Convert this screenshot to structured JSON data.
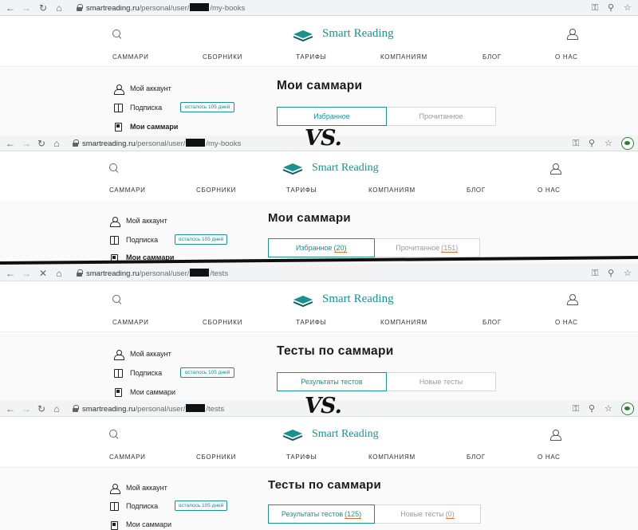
{
  "colors": {
    "accent": "#19928f",
    "count_underline": "#e8702a",
    "divider": "#0f0f0f"
  },
  "vs_label": "VS.",
  "comparisons": [
    {
      "before": {
        "url_host": "smartreading.ru",
        "url_prefix": "/personal/user/",
        "url_suffix": "/my-books",
        "logo_text": "Smart Reading",
        "menu": [
          "САММАРИ",
          "СБОРНИКИ",
          "ТАРИФЫ",
          "КОМПАНИЯМ",
          "БЛОГ",
          "О НАС"
        ],
        "sidebar": [
          {
            "label": "Мой аккаунт",
            "icon": "user-icon"
          },
          {
            "label": "Подписка",
            "icon": "book-icon",
            "badge": "осталось 105 дней"
          },
          {
            "label": "Мои саммари",
            "icon": "document-icon"
          }
        ],
        "page_title": "Мои саммари",
        "tabs": [
          {
            "label": "Избранное",
            "count": ""
          },
          {
            "label": "Прочитанное",
            "count": ""
          }
        ]
      },
      "after": {
        "url_host": "smartreading.ru",
        "url_prefix": "/personal/user/",
        "url_suffix": "/my-books",
        "logo_text": "Smart Reading",
        "menu": [
          "САММАРИ",
          "СБОРНИКИ",
          "ТАРИФЫ",
          "КОМПАНИЯМ",
          "БЛОГ",
          "О НАС"
        ],
        "sidebar": [
          {
            "label": "Мой аккаунт",
            "icon": "user-icon"
          },
          {
            "label": "Подписка",
            "icon": "book-icon",
            "badge": "осталось 105 дней"
          },
          {
            "label": "Мои саммари",
            "icon": "document-icon"
          }
        ],
        "page_title": "Мои саммари",
        "tabs": [
          {
            "label": "Избранное",
            "count": "(20)"
          },
          {
            "label": "Прочитанное",
            "count": "(151)"
          }
        ]
      }
    },
    {
      "before": {
        "url_host": "smartreading.ru",
        "url_prefix": "/personal/user/",
        "url_suffix": "/tests",
        "logo_text": "Smart Reading",
        "menu": [
          "САММАРИ",
          "СБОРНИКИ",
          "ТАРИФЫ",
          "КОМПАНИЯМ",
          "БЛОГ",
          "О НАС"
        ],
        "sidebar": [
          {
            "label": "Мой аккаунт",
            "icon": "user-icon"
          },
          {
            "label": "Подписка",
            "icon": "book-icon",
            "badge": "осталось 105 дней"
          },
          {
            "label": "Мои саммари",
            "icon": "document-icon"
          }
        ],
        "page_title": "Тесты по саммари",
        "tabs": [
          {
            "label": "Результаты тестов",
            "count": ""
          },
          {
            "label": "Новые тесты",
            "count": ""
          }
        ]
      },
      "after": {
        "url_host": "smartreading.ru",
        "url_prefix": "/personal/user/",
        "url_suffix": "/tests",
        "logo_text": "Smart Reading",
        "menu": [
          "САММАРИ",
          "СБОРНИКИ",
          "ТАРИФЫ",
          "КОМПАНИЯМ",
          "БЛОГ",
          "О НАС"
        ],
        "sidebar": [
          {
            "label": "Мой аккаунт",
            "icon": "user-icon"
          },
          {
            "label": "Подписка",
            "icon": "book-icon",
            "badge": "осталось 105 дней"
          },
          {
            "label": "Мои саммари",
            "icon": "document-icon"
          }
        ],
        "page_title": "Тесты по саммари",
        "tabs": [
          {
            "label": "Результаты тестов",
            "count": "(125)"
          },
          {
            "label": "Новые тесты",
            "count": "(0)"
          }
        ]
      }
    }
  ]
}
